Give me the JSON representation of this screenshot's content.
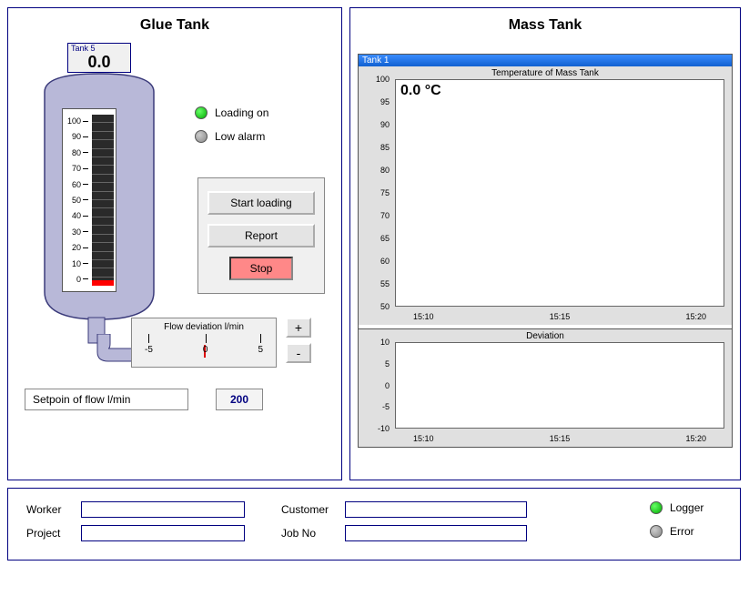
{
  "glue_tank": {
    "title": "Glue Tank",
    "label_name": "Tank 5",
    "level_value": "0.0",
    "level_scale": [
      "100",
      "90",
      "80",
      "70",
      "60",
      "50",
      "40",
      "30",
      "20",
      "10",
      "0"
    ],
    "indicators": {
      "loading_on": "Loading on",
      "low_alarm": "Low alarm"
    },
    "buttons": {
      "start": "Start loading",
      "report": "Report",
      "stop": "Stop"
    },
    "flow": {
      "title": "Flow deviation  l/min",
      "ticks": [
        "-5",
        "0",
        "5"
      ],
      "stepper_plus": "+",
      "stepper_minus": "-"
    },
    "setpoint_label": "Setpoin of flow l/min",
    "setpoint_value": "200"
  },
  "mass_tank": {
    "title": "Mass Tank",
    "tank_label": "Tank 1",
    "temp_reading": "0.0 °C"
  },
  "chart_data": [
    {
      "type": "line",
      "title": "Temperature of Mass Tank",
      "x_ticks": [
        "15:10",
        "15:15",
        "15:20"
      ],
      "y_ticks": [
        "100",
        "95",
        "90",
        "85",
        "80",
        "75",
        "70",
        "65",
        "60",
        "55",
        "50"
      ],
      "ylim": [
        50,
        100
      ],
      "series": [
        {
          "name": "Temperature",
          "values": []
        }
      ],
      "annotation": "0.0 °C"
    },
    {
      "type": "line",
      "title": "Deviation",
      "x_ticks": [
        "15:10",
        "15:15",
        "15:20"
      ],
      "y_ticks": [
        "10",
        "5",
        "0",
        "-5",
        "-10"
      ],
      "ylim": [
        -10,
        10
      ],
      "series": [
        {
          "name": "Deviation",
          "values": []
        }
      ]
    }
  ],
  "form": {
    "worker_label": "Worker",
    "project_label": "Project",
    "customer_label": "Customer",
    "jobno_label": "Job No",
    "worker": "",
    "project": "",
    "customer": "",
    "jobno": "",
    "logger_label": "Logger",
    "error_label": "Error"
  }
}
